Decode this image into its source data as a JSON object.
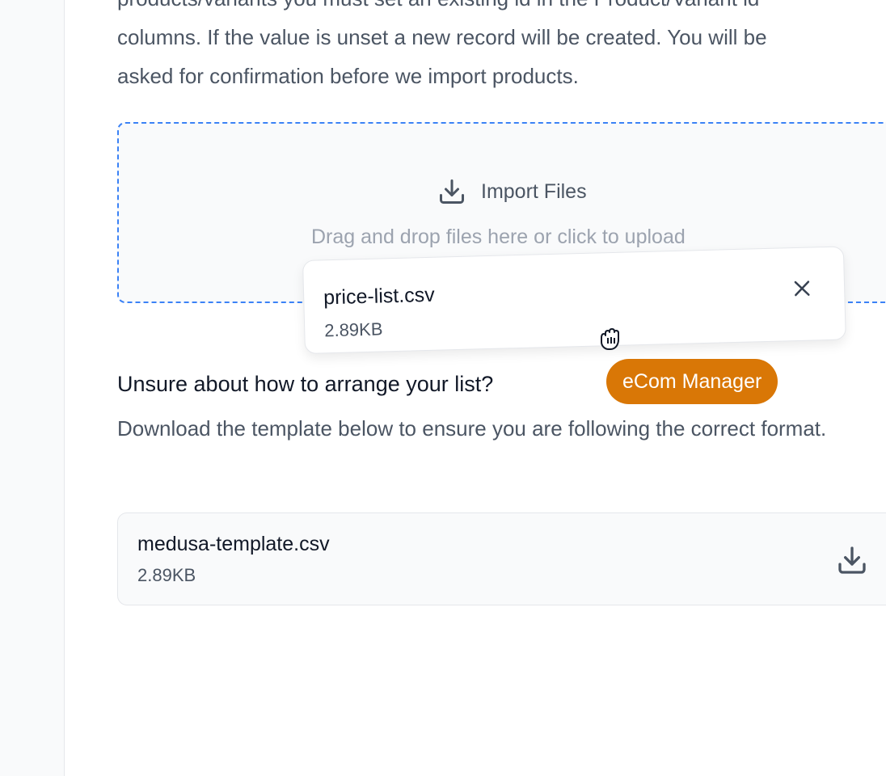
{
  "intro": {
    "text_line1": "products/variants you must set an existing id in the Product/Variant id",
    "text_line2": "columns. If the value is unset a new record will be created. You will be",
    "text_line3": "asked for confirmation before we import products."
  },
  "dropzone": {
    "title": "Import Files",
    "hint": "Drag and drop files here or click to upload",
    "icon": "download-icon",
    "border_color": "#3b82f6"
  },
  "dragged_file": {
    "name": "price-list.csv",
    "size": "2.89KB",
    "remove_icon": "close-icon"
  },
  "cursor": {
    "icon": "grab-hand-icon"
  },
  "user_badge": {
    "label": "eCom Manager",
    "color": "#d97706"
  },
  "template_section": {
    "title": "Unsure about how to arrange your list?",
    "description": "Download the template below to ensure you are following the correct format.",
    "file": {
      "name": "medusa-template.csv",
      "size": "2.89KB",
      "icon": "download-icon"
    }
  }
}
